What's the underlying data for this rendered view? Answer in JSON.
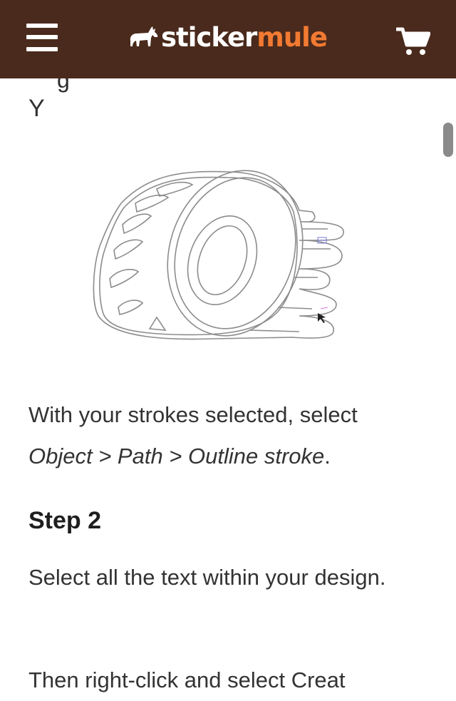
{
  "header": {
    "menu_icon": "hamburger-menu-icon",
    "logo_part1": "sticker",
    "logo_part2": "mule",
    "logo_icon": "mule-icon",
    "cart_icon": "shopping-cart-icon",
    "background_color": "#4a2a1c",
    "accent_color": "#f27a32"
  },
  "content": {
    "cut_off_top_text": "g",
    "letter": "Y",
    "paragraph1": {
      "text_before": "With your strokes selected, select ",
      "menu_path": "Object > Path > Outline stroke",
      "text_after": "."
    },
    "step_heading": "Step 2",
    "paragraph2": "Select all the text within your design.",
    "paragraph3_partial": "Then right-click and select Creat"
  }
}
